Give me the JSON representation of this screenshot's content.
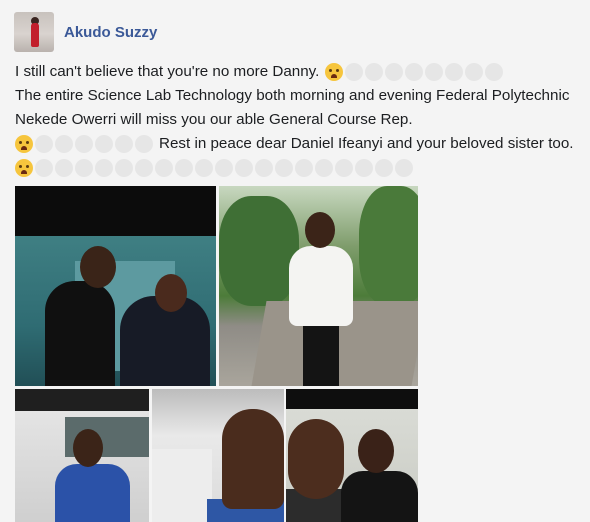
{
  "post": {
    "author": "Akudo Suzzy",
    "lines": [
      "I still can't believe that you're no more Danny.",
      "The entire Science Lab Technology both morning and evening Federal Polytechnic",
      "Nekede Owerri will miss you our able General Course Rep.",
      "Rest in peace dear Daniel Ifeanyi and your beloved sister too."
    ]
  },
  "icons": {
    "crying": "crying-face-emoji",
    "placeholder": "emoji-placeholder"
  },
  "colors": {
    "author": "#3b5998",
    "text": "#1c1e21",
    "background": "#f4f4f4"
  }
}
